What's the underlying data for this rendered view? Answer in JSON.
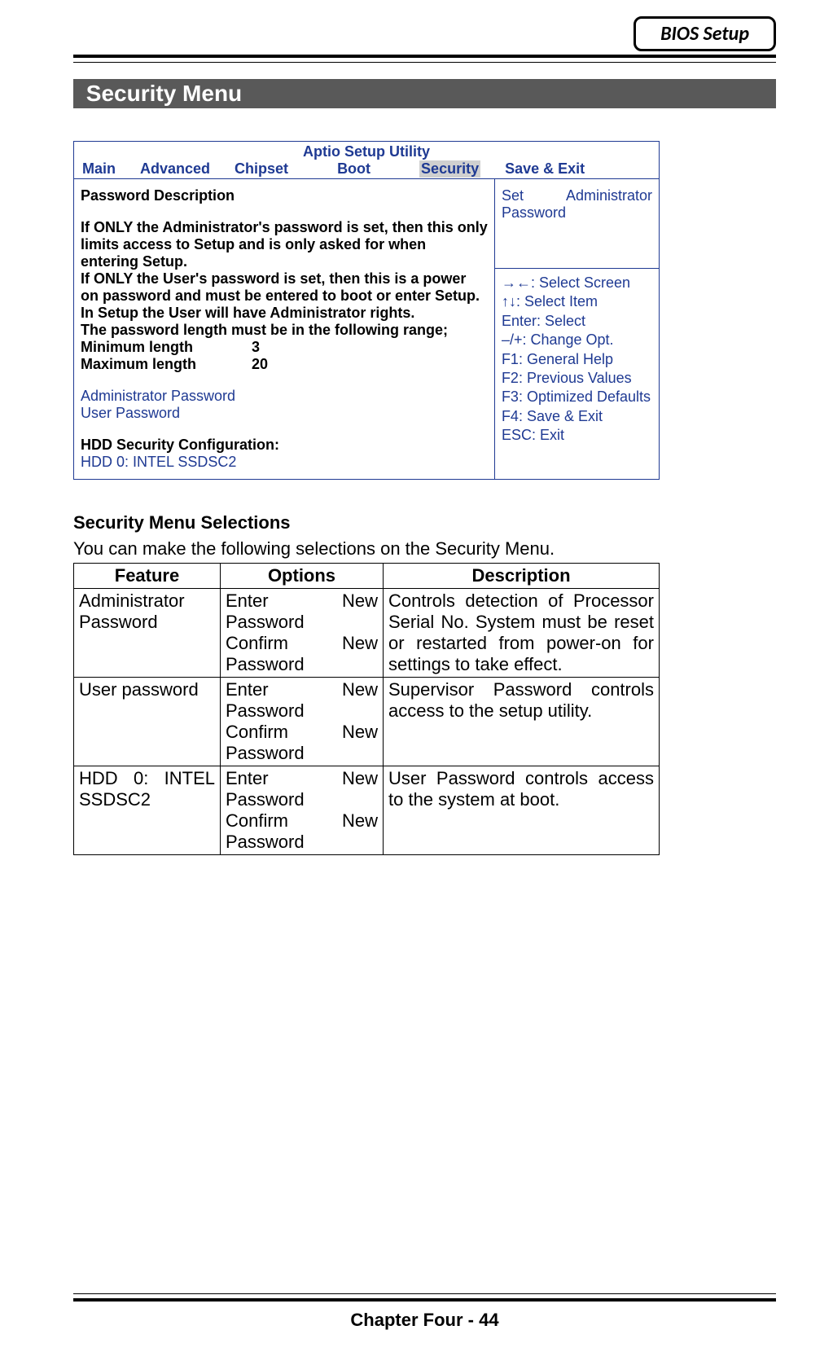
{
  "header": {
    "chip": "BIOS Setup"
  },
  "section_title": "Security Menu",
  "bios": {
    "utility_title": "Aptio Setup Utility",
    "tabs": {
      "main": "Main",
      "advanced": "Advanced",
      "chipset": "Chipset",
      "boot": "Boot",
      "security": "Security",
      "save_exit": "Save & Exit"
    },
    "left": {
      "heading": "Password Description",
      "para1": "If ONLY the Administrator's password is set, then this only limits access to Setup and is only asked for when entering Setup.",
      "para2": "If ONLY the User's password is set, then this is a power on password and must be entered to boot or enter Setup. In Setup the User will have Administrator rights.",
      "range_line": "The password length must be in the following range;",
      "min_label": "Minimum length",
      "min_value": "3",
      "max_label": "Maximum length",
      "max_value": "20",
      "admin_pw": "Administrator Password",
      "user_pw": "User Password",
      "hdd_heading": "HDD Security Configuration:",
      "hdd_item": "HDD 0: INTEL SSDSC2"
    },
    "right_top": {
      "word1": "Set",
      "word2": "Administrator",
      "word3": "Password"
    },
    "help": {
      "l1": "→←: Select Screen",
      "l2": "↑↓: Select Item",
      "l3": "Enter: Select",
      "l4": "–/+: Change Opt.",
      "l5": "F1: General Help",
      "l6": "F2: Previous Values",
      "l7": "F3: Optimized Defaults",
      "l8": "F4: Save & Exit",
      "l9": "ESC: Exit"
    }
  },
  "selections": {
    "heading": "Security Menu Selections",
    "intro": "You can make the following selections on the Security Menu.",
    "headers": {
      "feature": "Feature",
      "options": "Options",
      "description": "Description"
    },
    "rows": [
      {
        "feature": "Administrator Password",
        "opt_l1a": "Enter",
        "opt_l1b": "New",
        "opt_l2": "Password",
        "opt_l3a": "Confirm",
        "opt_l3b": "New",
        "opt_l4": "Password",
        "description": "Controls detection of Processor Serial No. System must be reset or restarted from power-on for settings to take effect."
      },
      {
        "feature": "User password",
        "opt_l1a": "Enter",
        "opt_l1b": "New",
        "opt_l2": "Password",
        "opt_l3a": "Confirm",
        "opt_l3b": "New",
        "opt_l4": "Password",
        "description": "Supervisor Password controls access to the setup utility."
      },
      {
        "feature": "HDD 0: INTEL SSDSC2",
        "opt_l1a": "Enter",
        "opt_l1b": "New",
        "opt_l2": "Password",
        "opt_l3a": "Confirm",
        "opt_l3b": "New",
        "opt_l4": "Password",
        "description": "User Password controls access to the system at boot."
      }
    ]
  },
  "footer": {
    "text": "Chapter Four - 44"
  }
}
